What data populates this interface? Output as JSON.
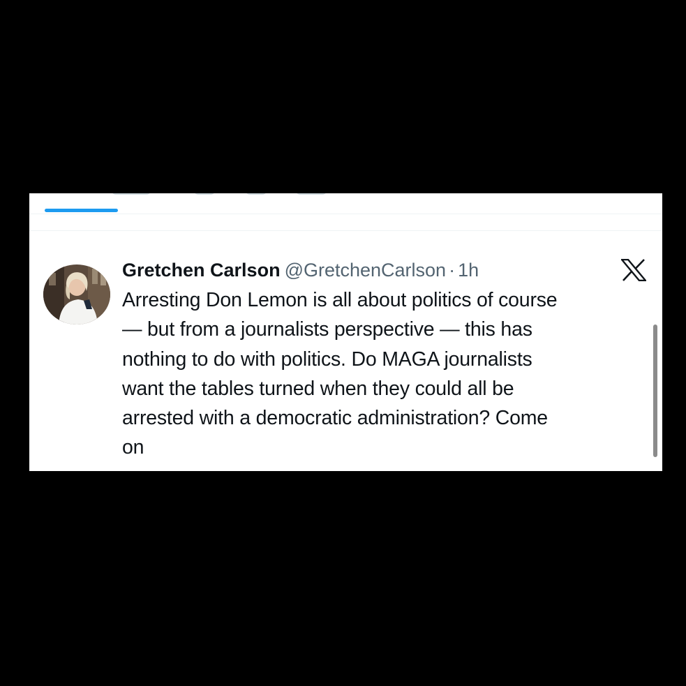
{
  "tweet": {
    "author_name": "Gretchen Carlson",
    "author_handle": "@GretchenCarlson",
    "separator": "·",
    "timestamp": "1h",
    "text": "Arresting Don Lemon is all about politics of course\n— but from a journalists perspective — this has\nnothing to do with politics. Do MAGA journalists\nwant the tables turned when they could all be\narrested with a democratic administration? Come\non"
  },
  "icons": {
    "platform_logo": "x-logo-icon",
    "avatar": "profile-photo"
  },
  "colors": {
    "accent": "#1d9bf0",
    "text_primary": "#0f1419",
    "text_secondary": "#536471",
    "divider": "#eff3f4",
    "frame": "#000000"
  }
}
